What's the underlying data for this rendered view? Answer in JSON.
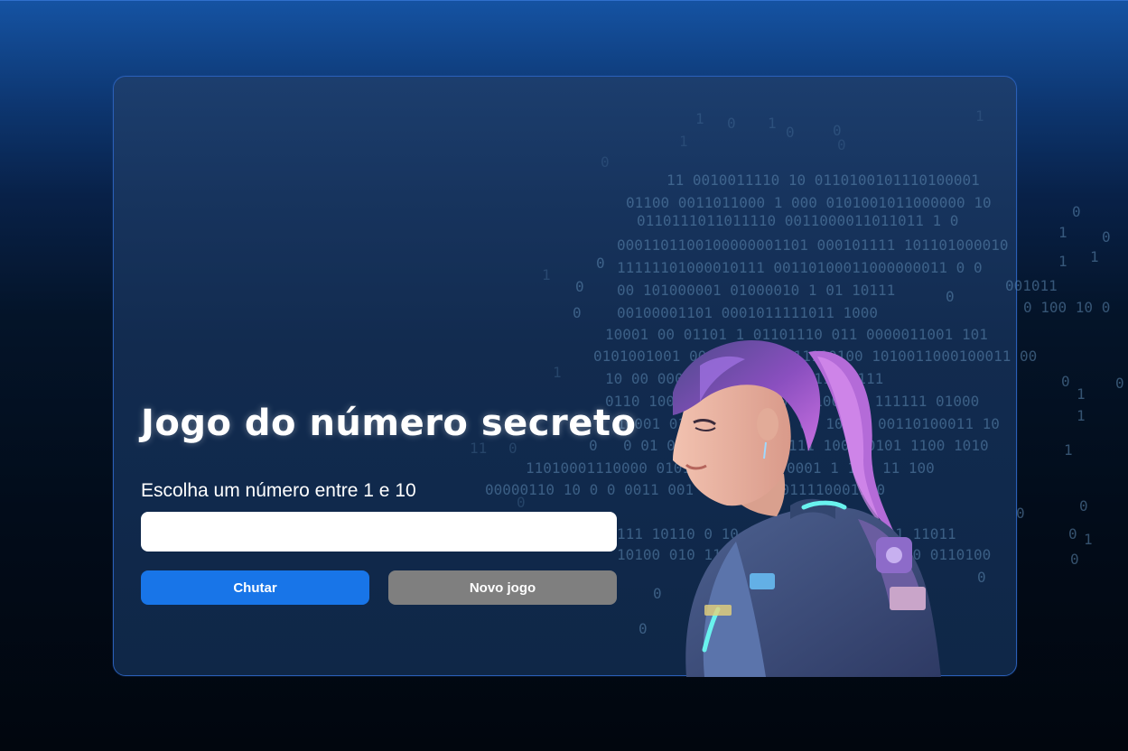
{
  "game": {
    "title": "Jogo do número secreto",
    "prompt_label": "Escolha um número entre 1 e 10",
    "guess_input_value": "",
    "guess_button_label": "Chutar",
    "new_game_button_label": "Novo jogo"
  },
  "colors": {
    "page_top": "#1553a3",
    "page_bottom": "#01060e",
    "card_border": "#2a5fb7",
    "card_bg": "#10294c",
    "guess_button": "#1875e8",
    "new_game_button": "#7f7f7f",
    "binary_text": "#5f8bb3"
  },
  "illustration": {
    "icon": "astronaut-girl-illustration",
    "background_icon": "binary-code-pattern"
  }
}
